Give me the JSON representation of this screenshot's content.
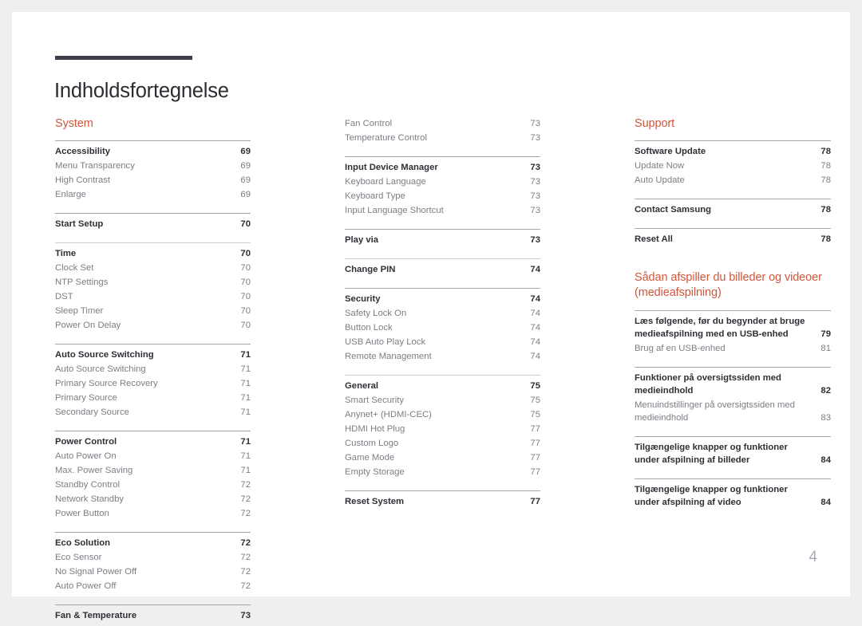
{
  "document": {
    "title": "Indholdsfortegnelse",
    "page_number": "4",
    "accent_color": "#d1563b",
    "rule_color": "#3f3f4c"
  },
  "columns": [
    {
      "heading": "System",
      "groups": [
        {
          "rule": "dark",
          "rows": [
            {
              "label": "Accessibility",
              "page": "69",
              "level": 0
            },
            {
              "label": "Menu Transparency",
              "page": "69",
              "level": 1
            },
            {
              "label": "High Contrast",
              "page": "69",
              "level": 1
            },
            {
              "label": "Enlarge",
              "page": "69",
              "level": 1
            }
          ]
        },
        {
          "rule": "dark",
          "rows": [
            {
              "label": "Start Setup",
              "page": "70",
              "level": 0
            }
          ]
        },
        {
          "rule": "light",
          "rows": [
            {
              "label": "Time",
              "page": "70",
              "level": 0
            },
            {
              "label": "Clock Set",
              "page": "70",
              "level": 1
            },
            {
              "label": "NTP Settings",
              "page": "70",
              "level": 1
            },
            {
              "label": "DST",
              "page": "70",
              "level": 1
            },
            {
              "label": "Sleep Timer",
              "page": "70",
              "level": 1
            },
            {
              "label": "Power On Delay",
              "page": "70",
              "level": 1
            }
          ]
        },
        {
          "rule": "dark",
          "rows": [
            {
              "label": "Auto Source Switching",
              "page": "71",
              "level": 0
            },
            {
              "label": "Auto Source Switching",
              "page": "71",
              "level": 1
            },
            {
              "label": "Primary Source Recovery",
              "page": "71",
              "level": 1
            },
            {
              "label": "Primary Source",
              "page": "71",
              "level": 1
            },
            {
              "label": "Secondary Source",
              "page": "71",
              "level": 1
            }
          ]
        },
        {
          "rule": "dark",
          "rows": [
            {
              "label": "Power Control",
              "page": "71",
              "level": 0
            },
            {
              "label": "Auto Power On",
              "page": "71",
              "level": 1
            },
            {
              "label": "Max. Power Saving",
              "page": "71",
              "level": 1
            },
            {
              "label": "Standby Control",
              "page": "72",
              "level": 1
            },
            {
              "label": "Network Standby",
              "page": "72",
              "level": 1
            },
            {
              "label": "Power Button",
              "page": "72",
              "level": 1
            }
          ]
        },
        {
          "rule": "dark",
          "rows": [
            {
              "label": "Eco Solution",
              "page": "72",
              "level": 0
            },
            {
              "label": "Eco Sensor",
              "page": "72",
              "level": 1
            },
            {
              "label": "No Signal Power Off",
              "page": "72",
              "level": 1
            },
            {
              "label": "Auto Power Off",
              "page": "72",
              "level": 1
            }
          ]
        },
        {
          "rule": "dark",
          "rows": [
            {
              "label": "Fan & Temperature",
              "page": "73",
              "level": 0
            }
          ]
        }
      ]
    },
    {
      "heading": "",
      "groups": [
        {
          "rule": "none",
          "rows": [
            {
              "label": "Fan Control",
              "page": "73",
              "level": 1
            },
            {
              "label": "Temperature Control",
              "page": "73",
              "level": 1
            }
          ]
        },
        {
          "rule": "dark",
          "rows": [
            {
              "label": "Input Device Manager",
              "page": "73",
              "level": 0
            },
            {
              "label": "Keyboard Language",
              "page": "73",
              "level": 1
            },
            {
              "label": "Keyboard Type",
              "page": "73",
              "level": 1
            },
            {
              "label": "Input Language Shortcut",
              "page": "73",
              "level": 1
            }
          ]
        },
        {
          "rule": "dark",
          "rows": [
            {
              "label": "Play via",
              "page": "73",
              "level": 0
            }
          ]
        },
        {
          "rule": "light",
          "rows": [
            {
              "label": "Change PIN",
              "page": "74",
              "level": 0
            }
          ]
        },
        {
          "rule": "dark",
          "rows": [
            {
              "label": "Security",
              "page": "74",
              "level": 0
            },
            {
              "label": "Safety Lock On",
              "page": "74",
              "level": 1
            },
            {
              "label": "Button Lock",
              "page": "74",
              "level": 1
            },
            {
              "label": "USB Auto Play Lock",
              "page": "74",
              "level": 1
            },
            {
              "label": "Remote Management",
              "page": "74",
              "level": 1
            }
          ]
        },
        {
          "rule": "light",
          "rows": [
            {
              "label": "General",
              "page": "75",
              "level": 0
            },
            {
              "label": "Smart Security",
              "page": "75",
              "level": 1
            },
            {
              "label": "Anynet+ (HDMI-CEC)",
              "page": "75",
              "level": 1
            },
            {
              "label": "HDMI Hot Plug",
              "page": "77",
              "level": 1
            },
            {
              "label": "Custom Logo",
              "page": "77",
              "level": 1
            },
            {
              "label": "Game Mode",
              "page": "77",
              "level": 1
            },
            {
              "label": "Empty Storage",
              "page": "77",
              "level": 1
            }
          ]
        },
        {
          "rule": "dark",
          "rows": [
            {
              "label": "Reset System",
              "page": "77",
              "level": 0
            }
          ]
        }
      ]
    },
    {
      "heading": "Support",
      "heading2": "Sådan afspiller du billeder og videoer (medieafspilning)",
      "groups": [
        {
          "rule": "dark",
          "rows": [
            {
              "label": "Software Update",
              "page": "78",
              "level": 0
            },
            {
              "label": "Update Now",
              "page": "78",
              "level": 1
            },
            {
              "label": "Auto Update",
              "page": "78",
              "level": 1
            }
          ]
        },
        {
          "rule": "dark",
          "rows": [
            {
              "label": "Contact Samsung",
              "page": "78",
              "level": 0
            }
          ]
        },
        {
          "rule": "dark",
          "rows": [
            {
              "label": "Reset All",
              "page": "78",
              "level": 0
            }
          ]
        }
      ],
      "groups2": [
        {
          "rule": "dark",
          "rows": [
            {
              "label": "Læs følgende, før du begynder at bruge medieafspilning med en USB-enhed",
              "page": "79",
              "level": 0
            },
            {
              "label": "Brug af en USB-enhed",
              "page": "81",
              "level": 1
            }
          ]
        },
        {
          "rule": "dark",
          "rows": [
            {
              "label": "Funktioner på oversigtssiden med medieindhold",
              "page": "82",
              "level": 0
            },
            {
              "label": "Menuindstillinger på oversigtssiden med medieindhold",
              "page": "83",
              "level": 1
            }
          ]
        },
        {
          "rule": "dark",
          "rows": [
            {
              "label": "Tilgængelige knapper og funktioner under afspilning af billeder",
              "page": "84",
              "level": 0
            }
          ]
        },
        {
          "rule": "dark",
          "rows": [
            {
              "label": "Tilgængelige knapper og funktioner under afspilning af video",
              "page": "84",
              "level": 0
            }
          ]
        }
      ]
    }
  ]
}
